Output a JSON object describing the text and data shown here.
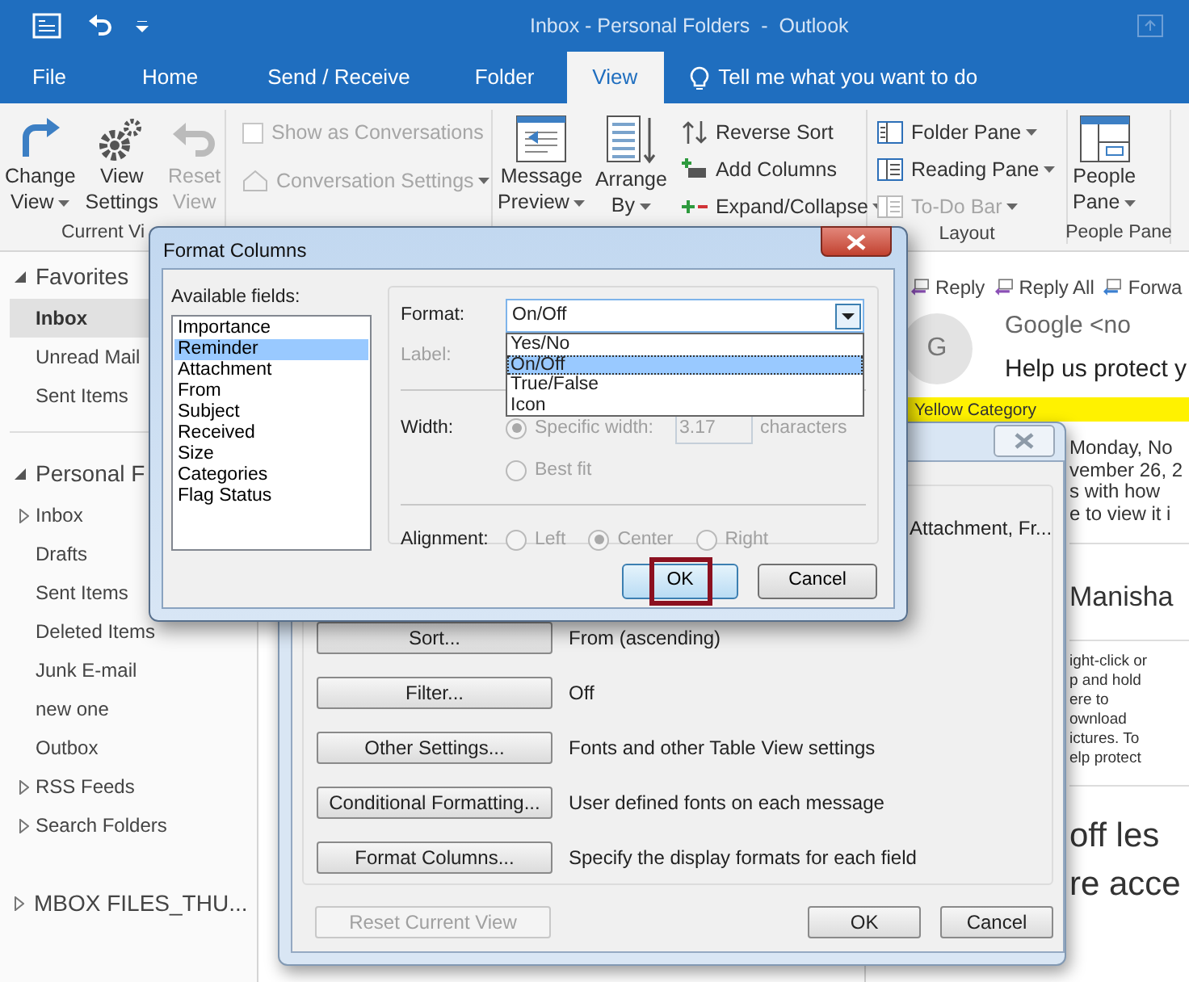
{
  "window": {
    "title": "Inbox - Personal Folders  -  Outlook"
  },
  "tabs": [
    {
      "label": "File",
      "selected": false
    },
    {
      "label": "Home",
      "selected": false
    },
    {
      "label": "Send / Receive",
      "selected": false
    },
    {
      "label": "Folder",
      "selected": false
    },
    {
      "label": "View",
      "selected": true
    }
  ],
  "tell_me": "Tell me what you want to do",
  "ribbon": {
    "groups": [
      {
        "label": "Current Vi",
        "large": [
          {
            "lines": [
              "Change",
              "View"
            ],
            "menu": true,
            "disabled": false
          },
          {
            "lines": [
              "View",
              "Settings"
            ],
            "menu": false,
            "disabled": false
          },
          {
            "lines": [
              "Reset",
              "View"
            ],
            "menu": false,
            "disabled": true
          }
        ]
      },
      {
        "small": [
          {
            "kind": "checkbox",
            "label": "Show as Conversations",
            "checked": false,
            "disabled": true
          },
          {
            "kind": "button",
            "label": "Conversation Settings",
            "menu": true,
            "disabled": true
          }
        ]
      },
      {
        "large": [
          {
            "lines": [
              "Message",
              "Preview"
            ],
            "menu": true,
            "disabled": false
          },
          {
            "lines": [
              "Arrange",
              "By"
            ],
            "menu": true,
            "disabled": false
          }
        ],
        "small": [
          {
            "kind": "button",
            "label": "Reverse Sort",
            "menu": false,
            "disabled": false
          },
          {
            "kind": "button",
            "label": "Add Columns",
            "menu": false,
            "disabled": false
          },
          {
            "kind": "button",
            "label": "Expand/Collapse",
            "menu": true,
            "disabled": false
          }
        ]
      },
      {
        "label": "Layout",
        "small": [
          {
            "kind": "button",
            "label": "Folder Pane",
            "menu": true,
            "disabled": false
          },
          {
            "kind": "button",
            "label": "Reading Pane",
            "menu": true,
            "disabled": false
          },
          {
            "kind": "button",
            "label": "To-Do Bar",
            "menu": true,
            "disabled": true
          }
        ]
      },
      {
        "label": "People Pane",
        "large": [
          {
            "lines": [
              "People",
              "Pane"
            ],
            "menu": true,
            "disabled": false
          }
        ]
      }
    ]
  },
  "nav": {
    "favorites": {
      "label": "Favorites",
      "expanded": true,
      "items": [
        {
          "label": "Inbox",
          "selected": true
        },
        {
          "label": "Unread Mail",
          "selected": false
        },
        {
          "label": "Sent Items",
          "selected": false
        }
      ]
    },
    "stores": [
      {
        "label": "Personal F",
        "expanded": true,
        "children": [
          {
            "label": "Inbox",
            "expanded": false
          },
          {
            "label": "Drafts"
          },
          {
            "label": "Sent Items"
          },
          {
            "label": "Deleted Items"
          },
          {
            "label": "Junk E-mail"
          },
          {
            "label": "new one"
          },
          {
            "label": "Outbox"
          },
          {
            "label": "RSS Feeds",
            "expanded": false
          },
          {
            "label": "Search Folders",
            "expanded": false
          }
        ]
      },
      {
        "label": "MBOX FILES_THU...",
        "expanded": false
      }
    ]
  },
  "reading_pane": {
    "actions": [
      "Reply",
      "Reply All",
      "Forwa"
    ],
    "avatar": "G",
    "sender": "Google <no",
    "subject": "Help us protect y",
    "category": "Yellow Category",
    "date_lines": [
      "Monday, No",
      "vember 26, 2"
    ],
    "intro_lines": [
      "s with how",
      "e to view it i"
    ],
    "name": "Manisha",
    "picture_note": [
      "ight-click or",
      "p and hold",
      "ere to",
      "ownload",
      "ictures. To",
      "elp protect"
    ],
    "heading_lines": [
      "off les",
      "re acce"
    ]
  },
  "view_settings_dialog": {
    "columns_summary": "Attachment, Fr...",
    "rows": [
      {
        "button": "Sort...",
        "value": "From (ascending)"
      },
      {
        "button": "Filter...",
        "value": "Off"
      },
      {
        "button": "Other Settings...",
        "value": "Fonts and other Table View settings"
      },
      {
        "button": "Conditional Formatting...",
        "value": "User defined fonts on each message"
      },
      {
        "button": "Format Columns...",
        "value": "Specify the display formats for each field"
      }
    ],
    "reset": {
      "label": "Reset Current View",
      "disabled": true
    },
    "buttons": [
      "OK",
      "Cancel"
    ]
  },
  "format_dialog": {
    "title": "Format Columns",
    "fields_label": "Available fields:",
    "fields": [
      {
        "label": "Importance",
        "selected": false
      },
      {
        "label": "Reminder",
        "selected": true
      },
      {
        "label": "Attachment",
        "selected": false
      },
      {
        "label": "From",
        "selected": false
      },
      {
        "label": "Subject",
        "selected": false
      },
      {
        "label": "Received",
        "selected": false
      },
      {
        "label": "Size",
        "selected": false
      },
      {
        "label": "Categories",
        "selected": false
      },
      {
        "label": "Flag Status",
        "selected": false
      }
    ],
    "format": {
      "label": "Format:",
      "value": "On/Off",
      "open": true,
      "options": [
        {
          "label": "Yes/No",
          "selected": false
        },
        {
          "label": "On/Off",
          "selected": true
        },
        {
          "label": "True/False",
          "selected": false
        },
        {
          "label": "Icon",
          "selected": false
        }
      ]
    },
    "label_field": {
      "label": "Label:",
      "disabled": true
    },
    "width": {
      "label": "Width:",
      "disabled": true,
      "options": [
        {
          "label": "Specific width:",
          "selected": true,
          "value": "3.17",
          "unit": "characters"
        },
        {
          "label": "Best fit",
          "selected": false
        }
      ]
    },
    "alignment": {
      "label": "Alignment:",
      "disabled": true,
      "options": [
        {
          "label": "Left",
          "selected": false
        },
        {
          "label": "Center",
          "selected": true
        },
        {
          "label": "Right",
          "selected": false
        }
      ]
    },
    "buttons": [
      {
        "label": "OK",
        "default": true,
        "highlighted": true
      },
      {
        "label": "Cancel",
        "default": false,
        "highlighted": false
      }
    ]
  }
}
